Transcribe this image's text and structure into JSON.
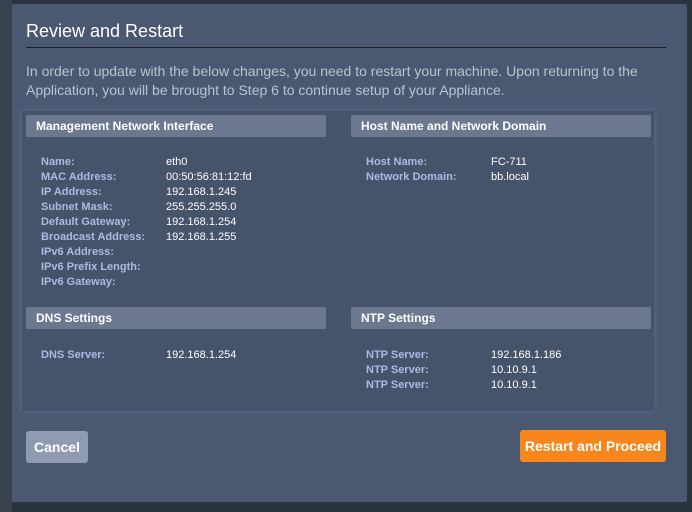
{
  "dialog": {
    "title": "Review and Restart",
    "intro": "In order to update with the below changes, you need to restart your machine. Upon returning to the Application, you will be brought to Step 6 to continue setup of your Appliance."
  },
  "management": {
    "header": "Management Network Interface",
    "rows": [
      {
        "key": "Name:",
        "value": "eth0"
      },
      {
        "key": "MAC Address:",
        "value": "00:50:56:81:12:fd"
      },
      {
        "key": "IP Address:",
        "value": "192.168.1.245"
      },
      {
        "key": "Subnet Mask:",
        "value": "255.255.255.0"
      },
      {
        "key": "Default Gateway:",
        "value": "192.168.1.254"
      },
      {
        "key": "Broadcast Address:",
        "value": "192.168.1.255"
      },
      {
        "key": "IPv6 Address:",
        "value": ""
      },
      {
        "key": "IPv6 Prefix Length:",
        "value": ""
      },
      {
        "key": "IPv6 Gateway:",
        "value": ""
      }
    ]
  },
  "hostname": {
    "header": "Host Name and Network Domain",
    "rows": [
      {
        "key": "Host Name:",
        "value": "FC-711"
      },
      {
        "key": "Network Domain:",
        "value": "bb.local"
      }
    ]
  },
  "dns": {
    "header": "DNS Settings",
    "rows": [
      {
        "key": "DNS Server:",
        "value": "192.168.1.254"
      }
    ]
  },
  "ntp": {
    "header": "NTP Settings",
    "rows": [
      {
        "key": "NTP Server:",
        "value": "192.168.1.186"
      },
      {
        "key": "NTP Server:",
        "value": "10.10.9.1"
      },
      {
        "key": "NTP Server:",
        "value": "10.10.9.1"
      }
    ]
  },
  "buttons": {
    "cancel": "Cancel",
    "restart": "Restart and Proceed"
  },
  "colors": {
    "accent": "#f7861c",
    "key_text": "#a9bde0"
  }
}
